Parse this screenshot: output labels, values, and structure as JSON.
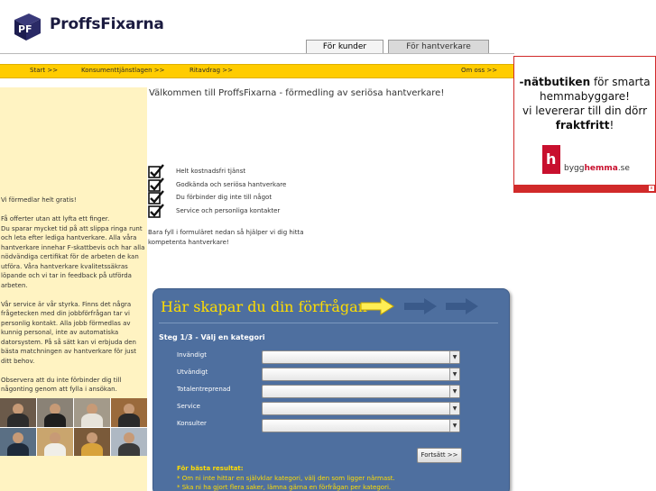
{
  "header": {
    "logo_text": "ProffsFixarna",
    "tabs": [
      "För kunder",
      "För hantverkare"
    ]
  },
  "nav": {
    "items": [
      "Start >>",
      "Konsumenttjänstlagen >>",
      "Ritavdrag >>",
      "Om oss >>"
    ]
  },
  "sidebar": {
    "title": "Vi förmedlar helt gratis!",
    "paragraphs": [
      "Få offerter utan att lyfta ett finger.",
      "Du sparar mycket tid på att slippa ringa runt och leta efter lediga hantverkare. Alla våra hantverkare innehar F-skattbevis och har alla nödvändiga certifikat för de arbeten de kan utföra. Våra hantverkare kvalitetssäkras löpande och vi tar in feedback på utförda arbeten.",
      "Vår service är vår styrka. Finns det några frågetecken med din jobbförfrågan tar vi personlig kontakt. Alla jobb förmedlas av kunnig personal, inte av automatiska datorsystem. På så sätt kan vi erbjuda den bästa matchningen av hantverkare för just ditt behov.",
      "Observera att du inte förbinder dig till någonting genom att fylla i ansökan."
    ]
  },
  "main": {
    "welcome": "Välkommen till ProffsFixarna - förmedling av seriösa hantverkare!",
    "features": [
      "Helt kostnadsfri tjänst",
      "Godkända och seriösa hantverkare",
      "Du förbinder dig inte till något",
      "Service och personliga kontakter"
    ],
    "intro": "Bara fyll i formuläret nedan så hjälper vi dig hitta kompetenta hantverkare!"
  },
  "form": {
    "title": "Här skapar du din förfrågan",
    "step": "Steg 1/3 - Välj en kategori",
    "rows": [
      {
        "label": "Invändigt",
        "value": ""
      },
      {
        "label": "Utvändigt",
        "value": ""
      },
      {
        "label": "Totalentreprenad",
        "value": ""
      },
      {
        "label": "Service",
        "value": ""
      },
      {
        "label": "Konsulter",
        "value": ""
      }
    ],
    "next_label": "Fortsätt >>",
    "tips_heading": "För bästa resultat:",
    "tips": [
      "* Om ni inte hittar en självklar kategori, välj den som ligger närmast.",
      "* Ska ni ha gjort flera saker, lämna gärna en förfrågan per kategori."
    ],
    "colors": {
      "panel": "#4e6f9f",
      "accent": "#ffdd00"
    }
  },
  "ad": {
    "line1_bold": "-nätbutiken",
    "line1_rest": " för smarta",
    "line2": "hemmabyggare!",
    "line3": "vi levererar till din dörr",
    "line4_bold": "fraktfritt",
    "line4_rest": "!",
    "brand_prefix": "bygg",
    "brand_main": "hemma",
    "brand_suffix": ".se",
    "close": "x"
  }
}
